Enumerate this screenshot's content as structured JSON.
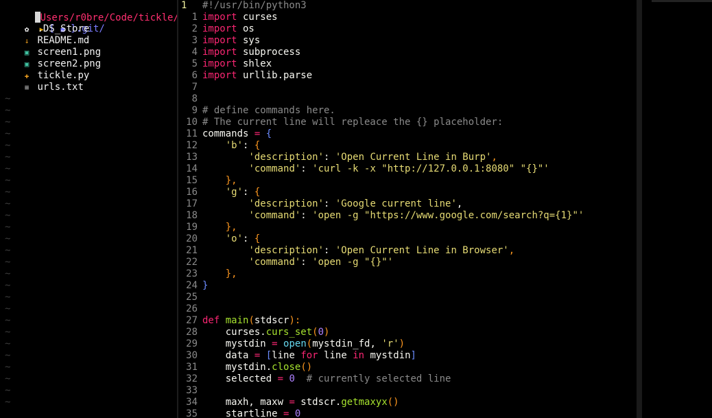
{
  "tree": {
    "header_path": "Users/r0bre/Code/tickle/",
    "dir": {
      "prefix": "[ ",
      "folder_glyph": "■",
      "suffix": " ].git/",
      "arrow": "▶"
    },
    "files": [
      {
        "name": ".DS_Store",
        "icon": "gear-icon",
        "glyph": "✿",
        "color": "#ffffff"
      },
      {
        "name": "README.md",
        "icon": "download-icon",
        "glyph": "↓",
        "color": "#f0a020"
      },
      {
        "name": "screen1.png",
        "icon": "image-icon",
        "glyph": "▣",
        "color": "#3fc0a0"
      },
      {
        "name": "screen2.png",
        "icon": "image-icon",
        "glyph": "▣",
        "color": "#3fc0a0"
      },
      {
        "name": "tickle.py",
        "icon": "python-icon",
        "glyph": "✚",
        "color": "#f0a020"
      },
      {
        "name": "urls.txt",
        "icon": "text-file-icon",
        "glyph": "≡",
        "color": "#e0e0e0"
      }
    ],
    "empty_marker": "~",
    "empty_rows": 27
  },
  "editor": {
    "current_line": "1",
    "lines": [
      {
        "n": "1",
        "tokens": [
          [
            "cm",
            "#!/usr/bin/python3"
          ]
        ]
      },
      {
        "n": "1",
        "tokens": [
          [
            "kw",
            "import"
          ],
          [
            "pl",
            " curses"
          ]
        ]
      },
      {
        "n": "2",
        "tokens": [
          [
            "kw",
            "import"
          ],
          [
            "pl",
            " os"
          ]
        ]
      },
      {
        "n": "3",
        "tokens": [
          [
            "kw",
            "import"
          ],
          [
            "pl",
            " sys"
          ]
        ]
      },
      {
        "n": "4",
        "tokens": [
          [
            "kw",
            "import"
          ],
          [
            "pl",
            " subprocess"
          ]
        ]
      },
      {
        "n": "5",
        "tokens": [
          [
            "kw",
            "import"
          ],
          [
            "pl",
            " shlex"
          ]
        ]
      },
      {
        "n": "6",
        "tokens": [
          [
            "kw",
            "import"
          ],
          [
            "pl",
            " urllib.parse"
          ]
        ]
      },
      {
        "n": "7",
        "tokens": []
      },
      {
        "n": "8",
        "tokens": []
      },
      {
        "n": "9",
        "tokens": [
          [
            "cm",
            "# define commands here."
          ]
        ]
      },
      {
        "n": "10",
        "tokens": [
          [
            "cm",
            "# The current line will repleace the {} placeholder:"
          ]
        ]
      },
      {
        "n": "11",
        "tokens": [
          [
            "pl",
            "commands "
          ],
          [
            "op",
            "="
          ],
          [
            "pl",
            " "
          ],
          [
            "blue",
            "{"
          ]
        ]
      },
      {
        "n": "12",
        "tokens": [
          [
            "pl",
            "    "
          ],
          [
            "str",
            "'b'"
          ],
          [
            "pl",
            ": "
          ],
          [
            "br",
            "{"
          ]
        ]
      },
      {
        "n": "13",
        "tokens": [
          [
            "pl",
            "        "
          ],
          [
            "str",
            "'description'"
          ],
          [
            "pl",
            ": "
          ],
          [
            "str",
            "'Open Current Line in Burp'"
          ],
          [
            "br",
            ","
          ]
        ]
      },
      {
        "n": "14",
        "tokens": [
          [
            "pl",
            "        "
          ],
          [
            "str",
            "'command'"
          ],
          [
            "pl",
            ": "
          ],
          [
            "str",
            "'curl -k -x \"http://127.0.0.1:8080\" \"{}\"'"
          ]
        ]
      },
      {
        "n": "15",
        "tokens": [
          [
            "pl",
            "    "
          ],
          [
            "br",
            "},"
          ]
        ]
      },
      {
        "n": "16",
        "tokens": [
          [
            "pl",
            "    "
          ],
          [
            "str",
            "'g'"
          ],
          [
            "pl",
            ": "
          ],
          [
            "br",
            "{"
          ]
        ]
      },
      {
        "n": "17",
        "tokens": [
          [
            "pl",
            "        "
          ],
          [
            "str",
            "'description'"
          ],
          [
            "pl",
            ": "
          ],
          [
            "str",
            "'Google current line'"
          ],
          [
            "pl",
            ","
          ]
        ]
      },
      {
        "n": "18",
        "tokens": [
          [
            "pl",
            "        "
          ],
          [
            "str",
            "'command'"
          ],
          [
            "pl",
            ": "
          ],
          [
            "str",
            "'open -g \"https://www.google.com/search?q={1}\"'"
          ]
        ]
      },
      {
        "n": "19",
        "tokens": [
          [
            "pl",
            "    "
          ],
          [
            "br",
            "},"
          ]
        ]
      },
      {
        "n": "20",
        "tokens": [
          [
            "pl",
            "    "
          ],
          [
            "str",
            "'o'"
          ],
          [
            "pl",
            ": "
          ],
          [
            "br",
            "{"
          ]
        ]
      },
      {
        "n": "21",
        "tokens": [
          [
            "pl",
            "        "
          ],
          [
            "str",
            "'description'"
          ],
          [
            "pl",
            ": "
          ],
          [
            "str",
            "'Open Current Line in Browser'"
          ],
          [
            "br",
            ","
          ]
        ]
      },
      {
        "n": "22",
        "tokens": [
          [
            "pl",
            "        "
          ],
          [
            "str",
            "'command'"
          ],
          [
            "pl",
            ": "
          ],
          [
            "str",
            "'open -g \"{}\"'"
          ]
        ]
      },
      {
        "n": "23",
        "tokens": [
          [
            "pl",
            "    "
          ],
          [
            "br",
            "},"
          ]
        ]
      },
      {
        "n": "24",
        "tokens": [
          [
            "blue",
            "}"
          ]
        ]
      },
      {
        "n": "25",
        "tokens": []
      },
      {
        "n": "26",
        "tokens": []
      },
      {
        "n": "27",
        "tokens": [
          [
            "kw",
            "def"
          ],
          [
            "pl",
            " "
          ],
          [
            "fn",
            "main"
          ],
          [
            "br",
            "("
          ],
          [
            "pl",
            "stdscr"
          ],
          [
            "br",
            "):"
          ]
        ]
      },
      {
        "n": "28",
        "tokens": [
          [
            "pl",
            "    curses."
          ],
          [
            "fn",
            "curs_set"
          ],
          [
            "br",
            "("
          ],
          [
            "num",
            "0"
          ],
          [
            "br",
            ")"
          ]
        ]
      },
      {
        "n": "29",
        "tokens": [
          [
            "pl",
            "    mystdin "
          ],
          [
            "op",
            "="
          ],
          [
            "pl",
            " "
          ],
          [
            "bi",
            "open"
          ],
          [
            "br",
            "("
          ],
          [
            "pl",
            "mystdin_fd, "
          ],
          [
            "str",
            "'r'"
          ],
          [
            "br",
            ")"
          ]
        ]
      },
      {
        "n": "30",
        "tokens": [
          [
            "pl",
            "    data "
          ],
          [
            "op",
            "="
          ],
          [
            "pl",
            " "
          ],
          [
            "blue",
            "["
          ],
          [
            "pl",
            "line "
          ],
          [
            "kw",
            "for"
          ],
          [
            "pl",
            " line "
          ],
          [
            "kw",
            "in"
          ],
          [
            "pl",
            " mystdin"
          ],
          [
            "blue",
            "]"
          ]
        ]
      },
      {
        "n": "31",
        "tokens": [
          [
            "pl",
            "    mystdin."
          ],
          [
            "fn",
            "close"
          ],
          [
            "br",
            "()"
          ]
        ]
      },
      {
        "n": "32",
        "tokens": [
          [
            "pl",
            "    selected "
          ],
          [
            "op",
            "="
          ],
          [
            "pl",
            " "
          ],
          [
            "num",
            "0"
          ],
          [
            "pl",
            "  "
          ],
          [
            "cm",
            "# currently selected line"
          ]
        ]
      },
      {
        "n": "33",
        "tokens": []
      },
      {
        "n": "34",
        "tokens": [
          [
            "pl",
            "    maxh, maxw "
          ],
          [
            "op",
            "="
          ],
          [
            "pl",
            " stdscr."
          ],
          [
            "fn",
            "getmaxyx"
          ],
          [
            "br",
            "()"
          ]
        ]
      },
      {
        "n": "35",
        "tokens": [
          [
            "pl",
            "    startline "
          ],
          [
            "op",
            "="
          ],
          [
            "pl",
            " "
          ],
          [
            "num",
            "0"
          ]
        ]
      }
    ]
  },
  "colors": {
    "background": "#000000",
    "keyword": "#f92672",
    "string": "#e6db74",
    "comment": "#8a8a8a",
    "function": "#a6e22e",
    "number": "#ae81ff",
    "tree_header": "#ff2f70",
    "dir": "#7a7cff"
  }
}
